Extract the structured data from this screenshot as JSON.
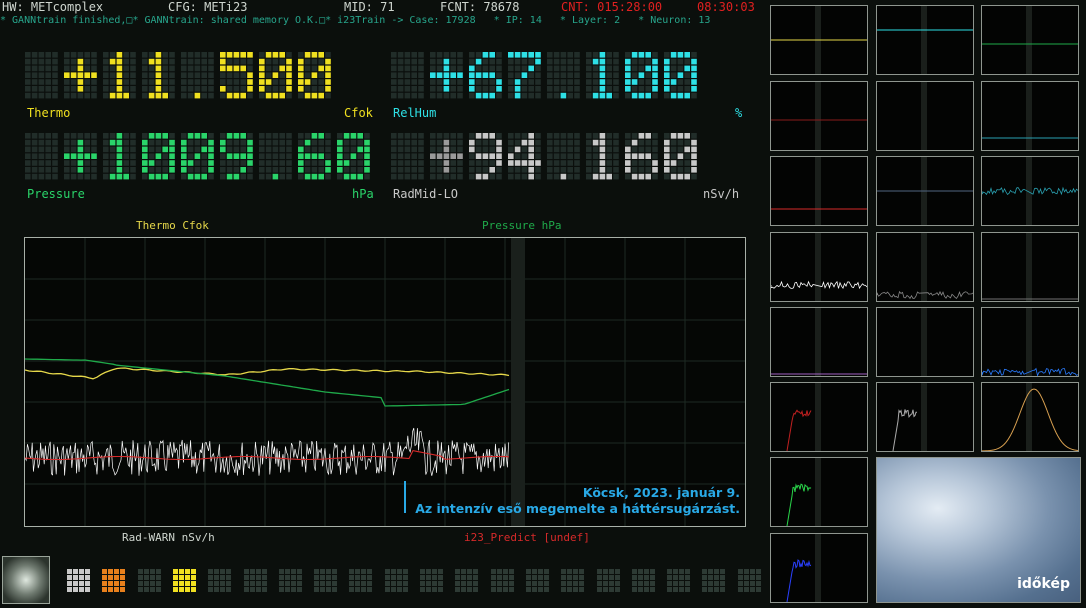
{
  "status": {
    "hw": "HW: METcomplex",
    "cfg": "CFG: METi23",
    "mid": "MID: 71",
    "fcnt": "FCNT: 78678",
    "cnt": "CNT: 015:28:00",
    "time": "08:30:03"
  },
  "infobar": "* GANNtrain finished,□* GANNtrain: shared memory O.K.□* i23Train -> Case: 17928   * IP: 14   * Layer: 2   * Neuron: 13",
  "displays": [
    {
      "sign": "+",
      "value": "11.500",
      "label": "Thermo",
      "unit": "Cfok",
      "color": "#f0e020",
      "sign_color": "#f0e020"
    },
    {
      "sign": "+",
      "value": "67.100",
      "label": "RelHum",
      "unit": "%",
      "color": "#2ee0e6",
      "sign_color": "#2ee0e6"
    },
    {
      "sign": "+",
      "value": "1009.60",
      "label": "Pressure",
      "unit": "hPa",
      "color": "#2ad46a",
      "sign_color": "#2ad46a"
    },
    {
      "sign": "+",
      "value": "94.160",
      "label": "RadMid-LO",
      "unit": "nSv/h",
      "color": "#c8c8c8",
      "sign_color": "#9a9a9a"
    }
  ],
  "chart_labels": {
    "top_left": "Thermo Cfok",
    "top_right": "Pressure hPa",
    "bottom_left": "Rad-WARN nSv/h",
    "bottom_right": "i23_Predict [undef]"
  },
  "annotation": {
    "line1": "Köcsk, 2023. január 9.",
    "line2": "Az intenzív eső megemelte a háttérsugárzást."
  },
  "photo_logo": "időkép",
  "colors": {
    "thermo": "#e6d84a",
    "pressure": "#1faa4a",
    "radiation": "#ffffff",
    "predict": "#d62a2a",
    "alarm": "#e02020"
  }
}
